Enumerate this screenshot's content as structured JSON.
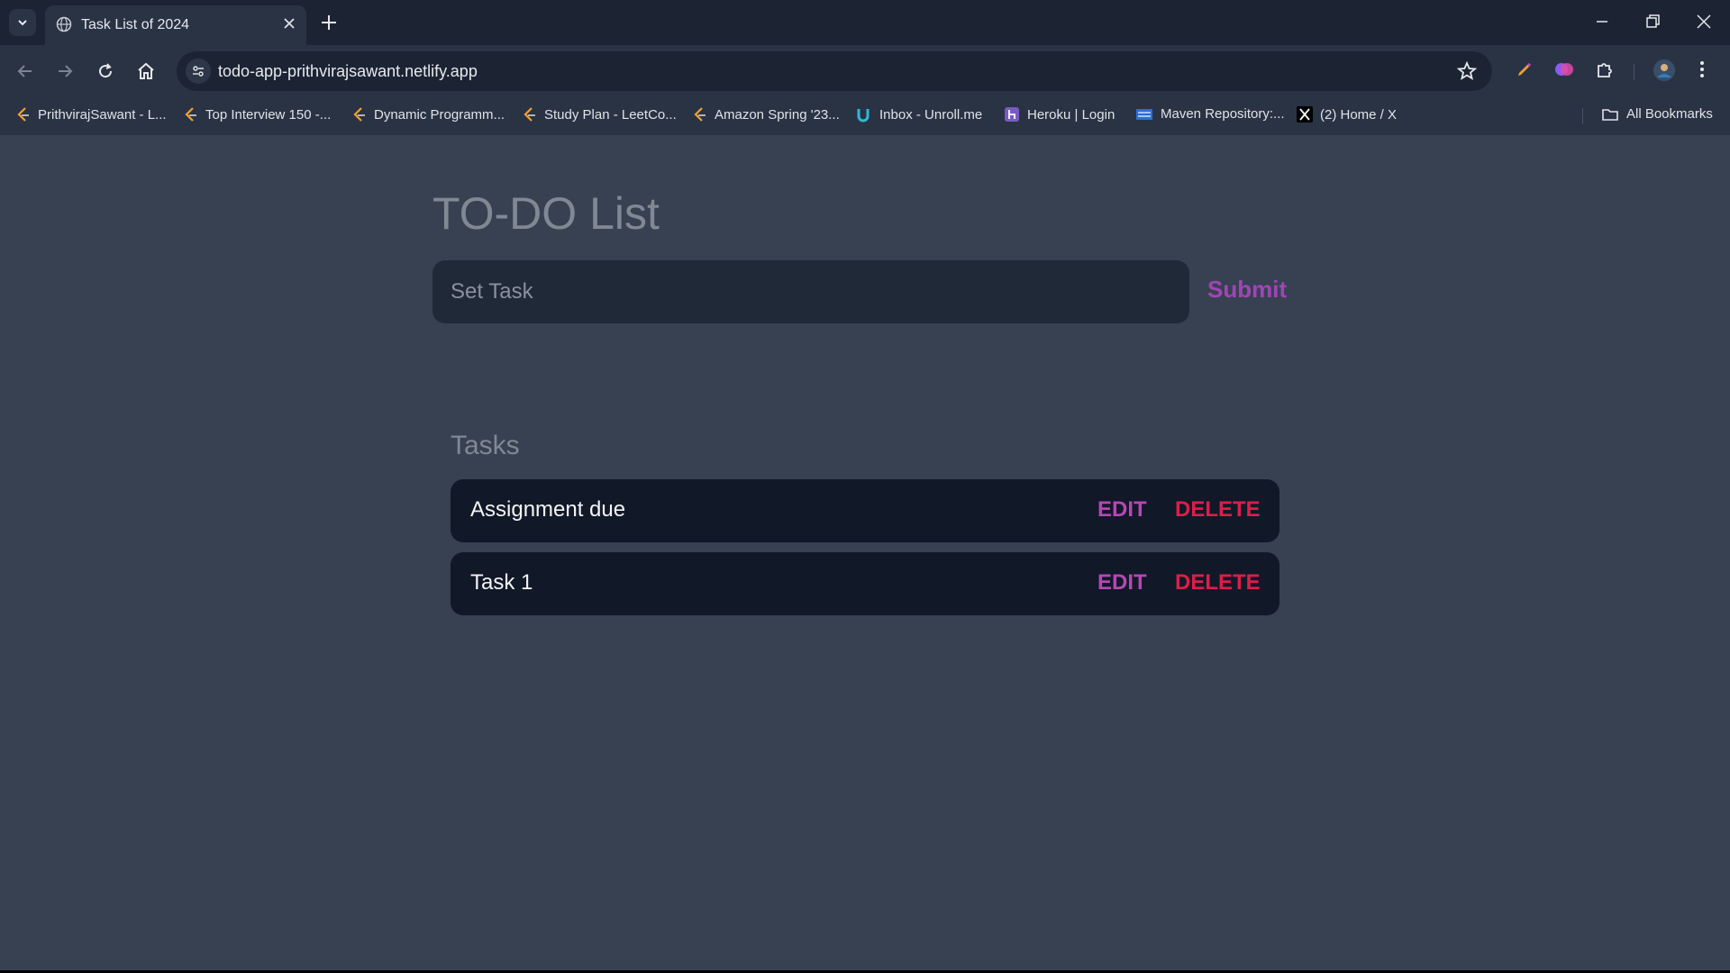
{
  "browser": {
    "tab": {
      "title": "Task List of 2024",
      "favicon": "globe-icon"
    },
    "url": "todo-app-prithvirajsawant.netlify.app",
    "bookmarks": [
      {
        "label": "PrithvirajSawant - L...",
        "icon": "leetcode-icon"
      },
      {
        "label": "Top Interview 150 -...",
        "icon": "leetcode-icon"
      },
      {
        "label": "Dynamic Programm...",
        "icon": "leetcode-icon"
      },
      {
        "label": "Study Plan - LeetCo...",
        "icon": "leetcode-icon"
      },
      {
        "label": "Amazon Spring '23...",
        "icon": "leetcode-icon"
      },
      {
        "label": "Inbox - Unroll.me",
        "icon": "unrollme-icon"
      },
      {
        "label": "Heroku | Login",
        "icon": "heroku-icon"
      },
      {
        "label": "Maven Repository:...",
        "icon": "maven-icon"
      },
      {
        "label": "(2) Home / X",
        "icon": "x-icon"
      }
    ],
    "all_bookmarks": "All Bookmarks"
  },
  "page": {
    "title": "TO-DO List",
    "input_placeholder": "Set Task",
    "input_value": "",
    "submit_label": "Submit",
    "tasks_heading": "Tasks",
    "tasks": [
      {
        "text": "Assignment due",
        "edit_label": "EDIT",
        "delete_label": "DELETE"
      },
      {
        "text": "Task 1",
        "edit_label": "EDIT",
        "delete_label": "DELETE"
      }
    ]
  },
  "colors": {
    "page_bg": "#374151",
    "input_bg": "#1f2937",
    "task_bg": "#111827",
    "submit": "#a045b8",
    "edit": "#b547b5",
    "delete": "#dc1e4a"
  }
}
